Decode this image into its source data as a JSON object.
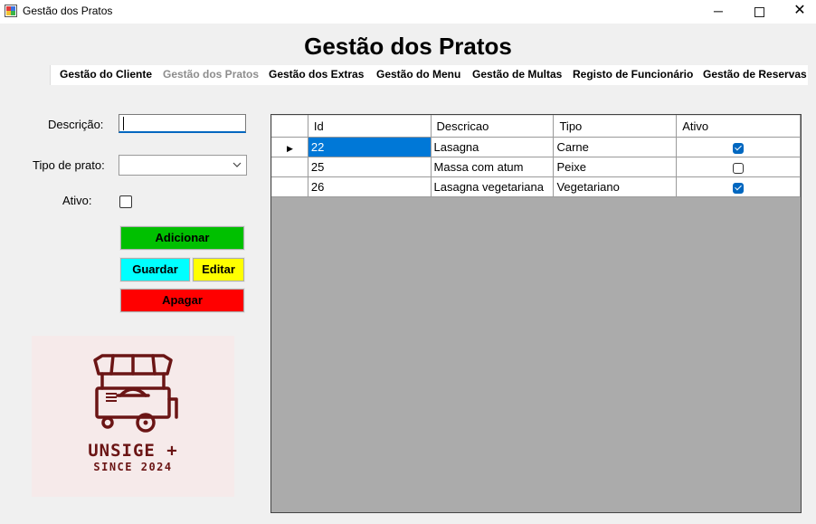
{
  "window": {
    "title": "Gestão dos Pratos",
    "minimize_glyph": "─",
    "close_glyph": "✕"
  },
  "page_title": "Gestão dos Pratos",
  "menu": [
    {
      "label": "Gestão do Cliente",
      "enabled": true
    },
    {
      "label": "Gestão dos Pratos",
      "enabled": false
    },
    {
      "label": "Gestão dos Extras",
      "enabled": true
    },
    {
      "label": "Gestão do Menu",
      "enabled": true
    },
    {
      "label": "Gestão de Multas",
      "enabled": true
    },
    {
      "label": "Registo de Funcionário",
      "enabled": true
    },
    {
      "label": "Gestão de Reservas",
      "enabled": true
    }
  ],
  "form": {
    "descricao_label": "Descrição:",
    "descricao_value": "",
    "tipo_label": "Tipo de prato:",
    "tipo_value": "",
    "ativo_label": "Ativo:",
    "ativo_checked": false
  },
  "buttons": {
    "adicionar": "Adicionar",
    "guardar": "Guardar",
    "editar": "Editar",
    "apagar": "Apagar"
  },
  "button_colors": {
    "adicionar": "#00c000",
    "guardar": "#00ffff",
    "editar": "#ffff00",
    "apagar": "#ff0000"
  },
  "logo": {
    "line1": "UNSIGE +",
    "line2": "SINCE 2024",
    "icon": "food-cart-icon",
    "color": "#6b1515"
  },
  "grid": {
    "columns": [
      "Id",
      "Descricao",
      "Tipo",
      "Ativo"
    ],
    "rows": [
      {
        "id": "22",
        "descricao": "Lasagna",
        "tipo": "Carne",
        "ativo": true,
        "current": true
      },
      {
        "id": "25",
        "descricao": "Massa com atum",
        "tipo": "Peixe",
        "ativo": false,
        "current": false
      },
      {
        "id": "26",
        "descricao": "Lasagna vegetariana",
        "tipo": "Vegetariano",
        "ativo": true,
        "current": false
      }
    ],
    "selection_color": "#0078d7",
    "background_color": "#ababab"
  }
}
